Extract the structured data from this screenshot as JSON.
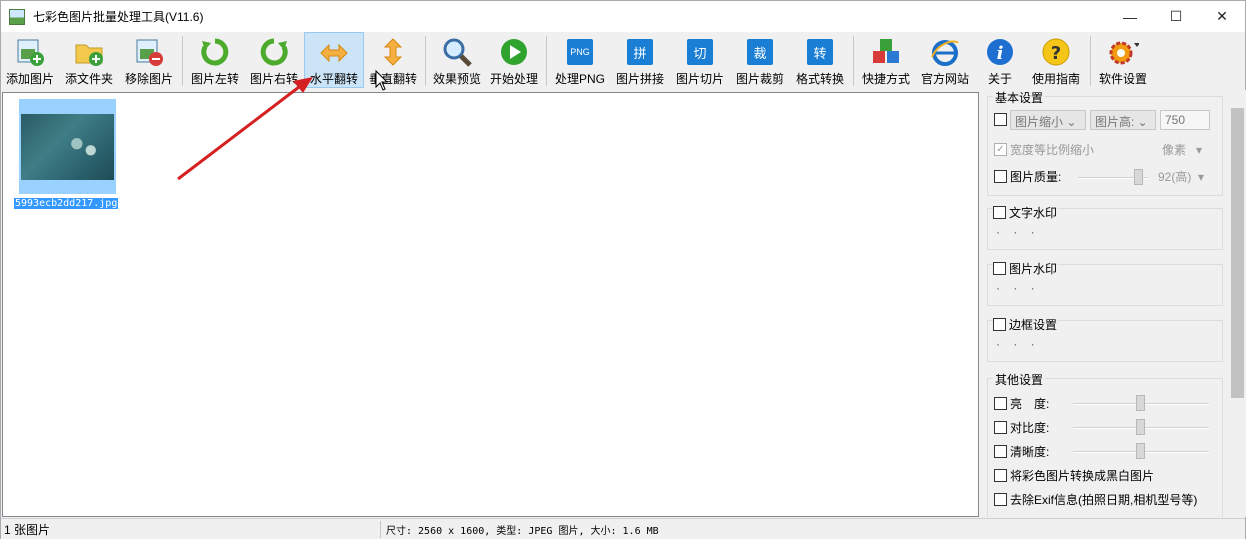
{
  "window": {
    "title": "七彩色图片批量处理工具(V11.6)"
  },
  "toolbar": {
    "add_image": "添加图片",
    "add_folder": "添文件夹",
    "remove_image": "移除图片",
    "rotate_left": "图片左转",
    "rotate_right": "图片右转",
    "flip_h": "水平翻转",
    "flip_v": "垂直翻转",
    "preview": "效果预览",
    "start": "开始处理",
    "png": "处理PNG",
    "png_icon": "PNG",
    "stitch": "图片拼接",
    "stitch_icon": "拼",
    "slice": "图片切片",
    "slice_icon": "切",
    "crop": "图片裁剪",
    "crop_icon": "裁",
    "convert": "格式转换",
    "convert_icon": "转",
    "shortcut": "快捷方式",
    "website": "官方网站",
    "about": "关于",
    "guide": "使用指南",
    "settings": "软件设置"
  },
  "file": {
    "name": "5993ecb2dd217.jpg"
  },
  "panel": {
    "basic": {
      "title": "基本设置",
      "shrink": "图片缩小",
      "height": "图片高:",
      "height_value": "750",
      "keep_ratio": "宽度等比例缩小",
      "unit": "像素",
      "quality": "图片质量:",
      "quality_value": "92(高)"
    },
    "text_watermark": {
      "title": "文字水印",
      "dots": "· · ·"
    },
    "image_watermark": {
      "title": "图片水印",
      "dots": "· · ·"
    },
    "border": {
      "title": "边框设置",
      "dots": "· · ·"
    },
    "other": {
      "title": "其他设置",
      "brightness": "亮　度:",
      "contrast": "对比度:",
      "sharpness": "清晰度:",
      "grayscale": "将彩色图片转换成黑白图片",
      "exif": "去除Exif信息(拍照日期,相机型号等)"
    }
  },
  "status": {
    "count": "1 张图片",
    "info": "尺寸: 2560 x 1600, 类型: JPEG 图片, 大小: 1.6 MB"
  },
  "colors": {
    "accent": "#1a7fd4",
    "selection": "#3399ff",
    "arrow": "#d42020"
  }
}
